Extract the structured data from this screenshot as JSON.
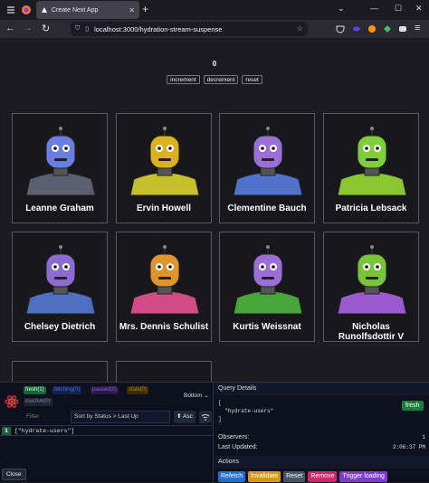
{
  "browser": {
    "tab_title": "Create Next App",
    "url": "localhost:3000/hydration-stream-suspense"
  },
  "page": {
    "counter": "0",
    "buttons": {
      "increment": "increment",
      "decrement": "decrement",
      "reset": "reset"
    },
    "users": [
      {
        "name": "Leanne Graham",
        "head": "#6a7ee0",
        "body": "#5b6070"
      },
      {
        "name": "Ervin Howell",
        "head": "#d9b21c",
        "body": "#c6c02a"
      },
      {
        "name": "Clementine Bauch",
        "head": "#9b6fd6",
        "body": "#4f73c9"
      },
      {
        "name": "Patricia Lebsack",
        "head": "#7fcf3a",
        "body": "#8bc82f"
      },
      {
        "name": "Chelsey Dietrich",
        "head": "#8c6bd2",
        "body": "#4e6fbf"
      },
      {
        "name": "Mrs. Dennis Schulist",
        "head": "#e0952a",
        "body": "#d24b86"
      },
      {
        "name": "Kurtis Weissnat",
        "head": "#9a6fd8",
        "body": "#46a63a"
      },
      {
        "name": "Nicholas Runolfsdottir V",
        "head": "#7ac43c",
        "body": "#9b5bd0"
      }
    ]
  },
  "devtools": {
    "filters": {
      "fresh": "fresh(1)",
      "fetching": "fetching(0)",
      "paused": "paused(0)",
      "stale": "stale(0)",
      "inactive": "inactive(0)"
    },
    "position": "Bottom",
    "filter_placeholder": "Filter",
    "sort": "Sort by Status > Last Up",
    "asc": "⬆ Asc",
    "query_count": "1",
    "query_key": "[\"hydrate-users\"]",
    "close": "Close",
    "details": {
      "header": "Query Details",
      "key_lines": "[\n  \"hydrate-users\"\n]",
      "status": "fresh",
      "observers_label": "Observers:",
      "observers_value": "1",
      "updated_label": "Last Updated:",
      "updated_value": "2:06:37 PM"
    },
    "actions_header": "Actions",
    "actions": [
      {
        "label": "Refetch",
        "color": "#1d6fd6"
      },
      {
        "label": "Invalidate",
        "color": "#d39b0b"
      },
      {
        "label": "Reset",
        "color": "#475569"
      },
      {
        "label": "Remove",
        "color": "#d4246b"
      },
      {
        "label": "Trigger loading",
        "color": "#7e3bd0"
      }
    ]
  }
}
